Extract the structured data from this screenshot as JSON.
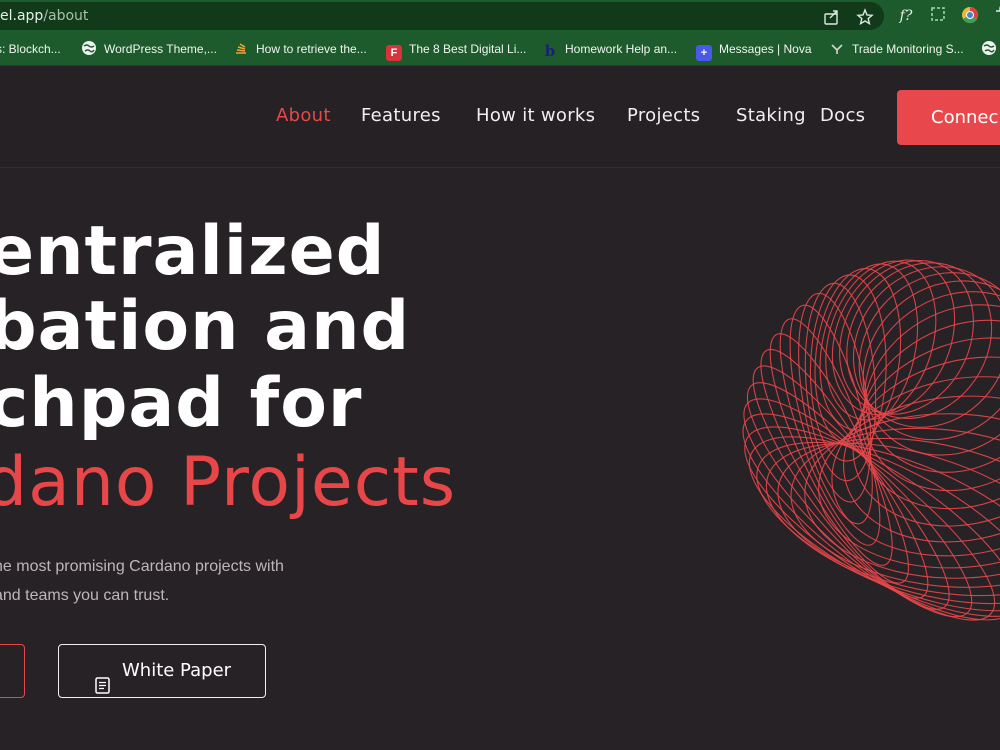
{
  "browser": {
    "url_host": "el.app",
    "url_path": "/about",
    "icons": [
      "share-icon",
      "star-icon",
      "fx-extension-icon",
      "screenshot-icon",
      "chrome-colors-icon",
      "puzzle-icon"
    ],
    "extension_label": "f?",
    "bookmarks": [
      {
        "label": "s: Blockch...",
        "icon": "none"
      },
      {
        "label": "WordPress Theme,...",
        "icon": "globe-icon"
      },
      {
        "label": "How to retrieve the...",
        "icon": "stack-icon"
      },
      {
        "label": "The 8 Best Digital Li...",
        "icon": "f-icon",
        "glyph": "F"
      },
      {
        "label": "Homework Help an...",
        "icon": "b-icon",
        "glyph": "b"
      },
      {
        "label": "Messages | Nova",
        "icon": "plus-icon",
        "glyph": "+"
      },
      {
        "label": "Trade Monitoring S...",
        "icon": "tm-icon"
      },
      {
        "label": "",
        "icon": "globe-icon"
      }
    ]
  },
  "nav": {
    "links": [
      "About",
      "Features",
      "How it works",
      "Projects",
      "Staking",
      "Docs"
    ],
    "active": "About",
    "connect_label": "Connec"
  },
  "hero": {
    "lines": [
      "entralized",
      "bation and",
      "chpad for"
    ],
    "accent_line": "dano Projects",
    "sub_lines": [
      "he most promising Cardano projects with",
      "and teams you can trust."
    ],
    "whitepaper_label": "White Paper",
    "doc_icon": "document-icon"
  },
  "colors": {
    "background": "#272226",
    "accent": "#e8474a",
    "browser_green": "#1e5b2c"
  }
}
